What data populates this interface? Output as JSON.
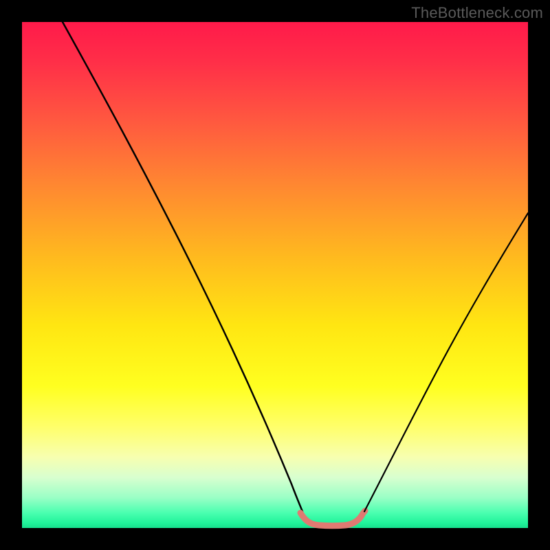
{
  "watermark": "TheBottleneck.com",
  "chart_data": {
    "type": "line",
    "title": "",
    "xlabel": "",
    "ylabel": "",
    "xlim": [
      0,
      100
    ],
    "ylim": [
      0,
      100
    ],
    "gradient_stops": [
      {
        "pos": 0,
        "color": "#ff1a4a"
      },
      {
        "pos": 8,
        "color": "#ff2f48"
      },
      {
        "pos": 20,
        "color": "#ff5a3f"
      },
      {
        "pos": 33,
        "color": "#ff8a30"
      },
      {
        "pos": 46,
        "color": "#ffb81f"
      },
      {
        "pos": 60,
        "color": "#ffe612"
      },
      {
        "pos": 72,
        "color": "#ffff20"
      },
      {
        "pos": 80,
        "color": "#ffff6a"
      },
      {
        "pos": 86,
        "color": "#f7ffb0"
      },
      {
        "pos": 90,
        "color": "#d8ffcf"
      },
      {
        "pos": 94,
        "color": "#9affc6"
      },
      {
        "pos": 97,
        "color": "#4affb0"
      },
      {
        "pos": 99,
        "color": "#20f39a"
      },
      {
        "pos": 100,
        "color": "#17e08d"
      }
    ],
    "series": [
      {
        "name": "left-curve",
        "color": "#000000",
        "x": [
          8,
          15,
          22,
          30,
          38,
          45,
          50,
          53,
          55
        ],
        "y": [
          100,
          86,
          72,
          56,
          40,
          24,
          10,
          4,
          2
        ]
      },
      {
        "name": "flat-segment",
        "color": "#e07a72",
        "x": [
          55,
          57,
          60,
          62,
          64,
          66,
          67
        ],
        "y": [
          2,
          0.8,
          0.5,
          0.5,
          0.6,
          1,
          2
        ]
      },
      {
        "name": "right-curve",
        "color": "#000000",
        "x": [
          67,
          72,
          78,
          84,
          90,
          96,
          100
        ],
        "y": [
          2,
          10,
          22,
          34,
          46,
          57,
          63
        ]
      }
    ]
  }
}
